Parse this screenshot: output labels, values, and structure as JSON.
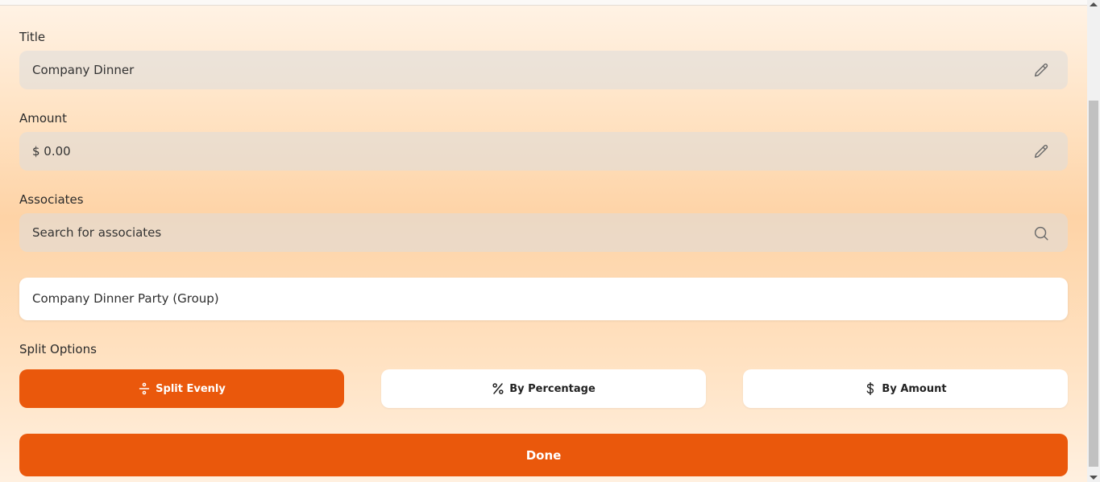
{
  "title_field": {
    "label": "Title",
    "value": "Company Dinner",
    "icon": "pencil-icon"
  },
  "amount_field": {
    "label": "Amount",
    "value": "$ 0.00",
    "icon": "pencil-icon"
  },
  "associates_field": {
    "label": "Associates",
    "placeholder": "Search for associates",
    "icon": "search-icon"
  },
  "group_card": {
    "text": "Company Dinner Party (Group)"
  },
  "split_options": {
    "label": "Split Options",
    "buttons": [
      {
        "label": "Split Evenly",
        "icon": "divide-icon",
        "active": true
      },
      {
        "label": "By Percentage",
        "icon": "percent-icon",
        "active": false
      },
      {
        "label": "By Amount",
        "icon": "dollar-icon",
        "active": false
      }
    ]
  },
  "done_button": {
    "label": "Done"
  },
  "colors": {
    "accent": "#ea580c",
    "field_bg": "#e8ddd3",
    "card_bg": "#ffffff"
  }
}
